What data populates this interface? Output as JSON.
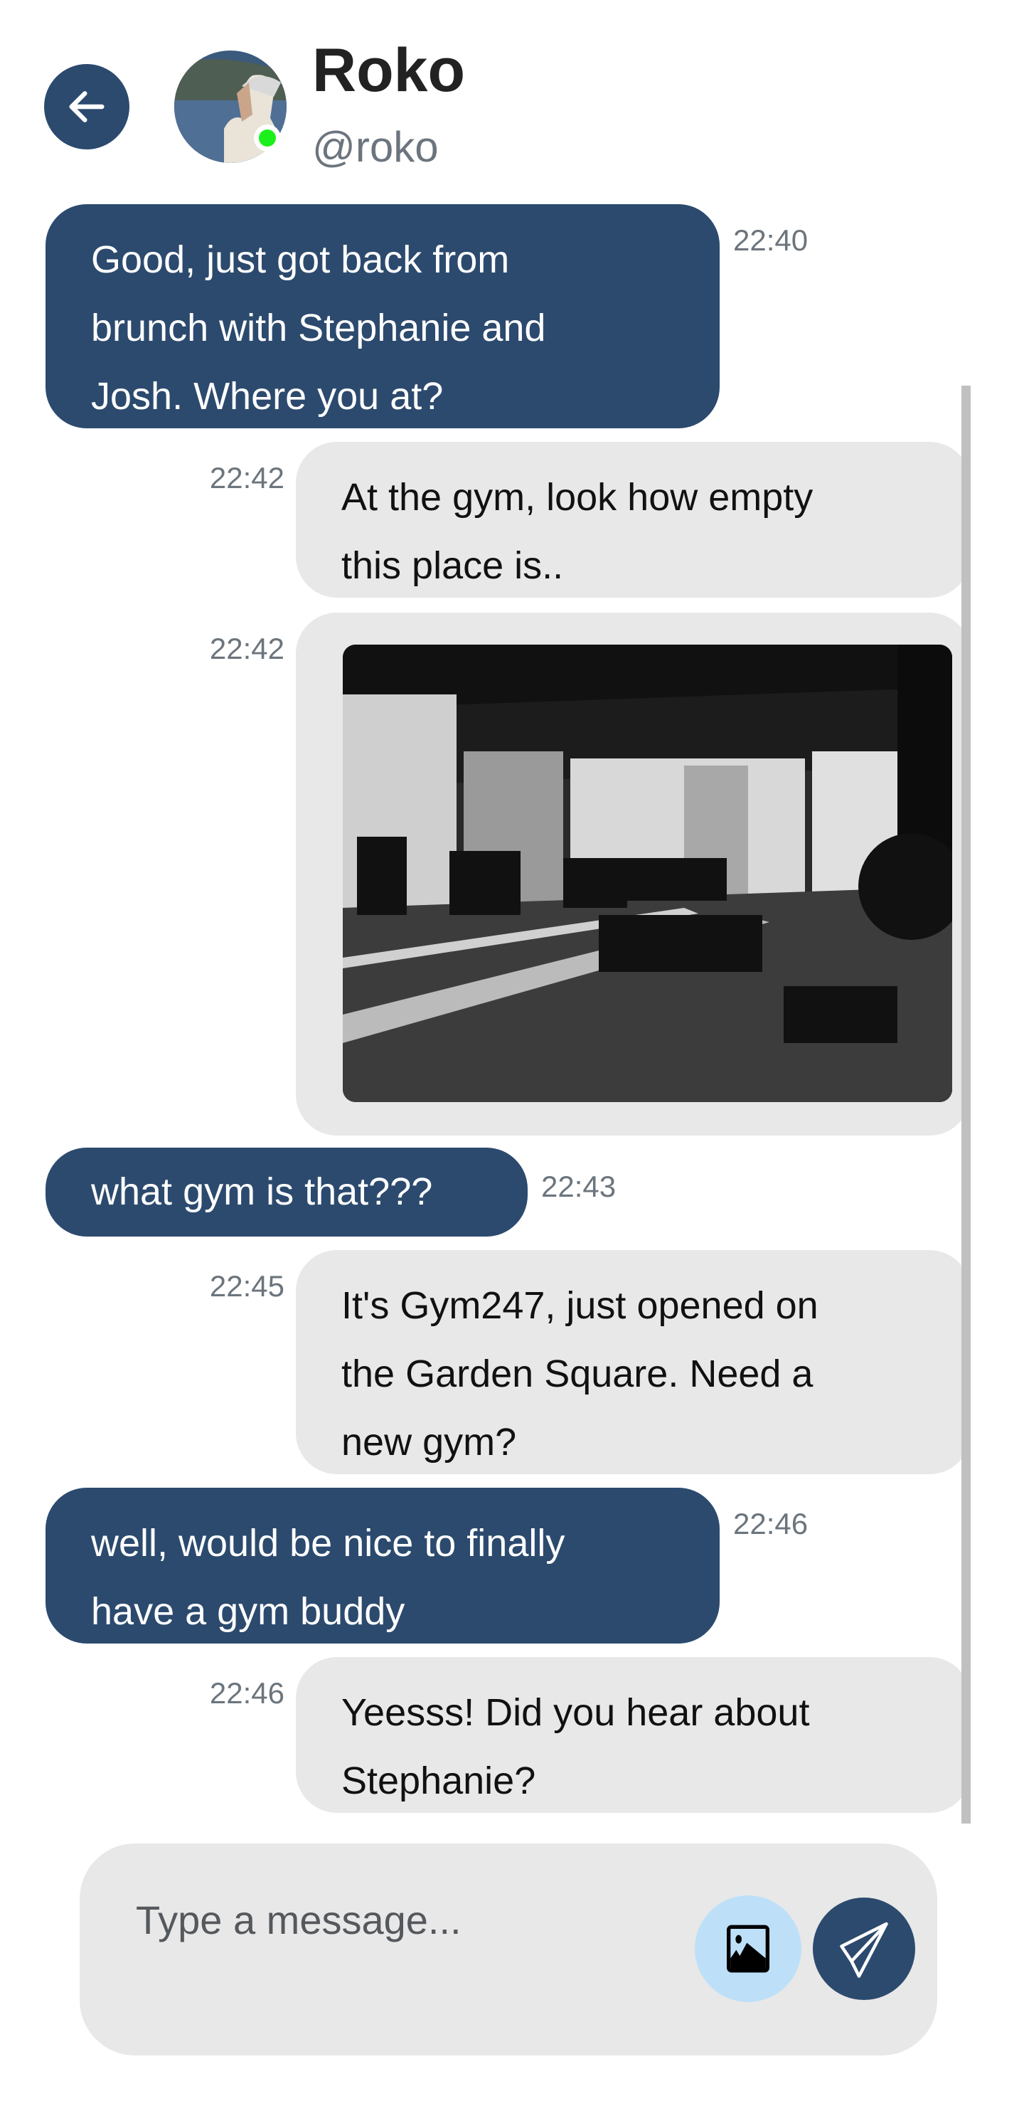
{
  "header": {
    "name": "Roko",
    "handle": "@roko",
    "status": "online",
    "back_icon": "arrow-left-icon"
  },
  "messages": [
    {
      "direction": "sent",
      "time": "22:40",
      "lines": [
        "Good, just got back from",
        "brunch with Stephanie and",
        "Josh. Where you at?"
      ]
    },
    {
      "direction": "received",
      "time": "22:42",
      "lines": [
        "At the gym, look how empty",
        "this place is.."
      ]
    },
    {
      "direction": "received",
      "time": "22:42",
      "type": "image"
    },
    {
      "direction": "sent",
      "time": "22:43",
      "lines": [
        "what gym is that???"
      ]
    },
    {
      "direction": "received",
      "time": "22:45",
      "lines": [
        "It's Gym247, just opened on",
        "the Garden Square. Need a",
        "new gym?"
      ]
    },
    {
      "direction": "sent",
      "time": "22:46",
      "lines": [
        "well, would be nice to finally",
        "have a gym buddy"
      ]
    },
    {
      "direction": "received",
      "time": "22:46",
      "lines": [
        "Yeesss! Did you hear about",
        "Stephanie?"
      ]
    }
  ],
  "composer": {
    "placeholder": "Type a message...",
    "image_icon": "image-icon",
    "send_icon": "send-icon"
  },
  "colors": {
    "primary": "#2c4a6e",
    "received_bubble": "#e8e8e8",
    "online": "#1cf01c",
    "image_button": "#bde0f8"
  }
}
